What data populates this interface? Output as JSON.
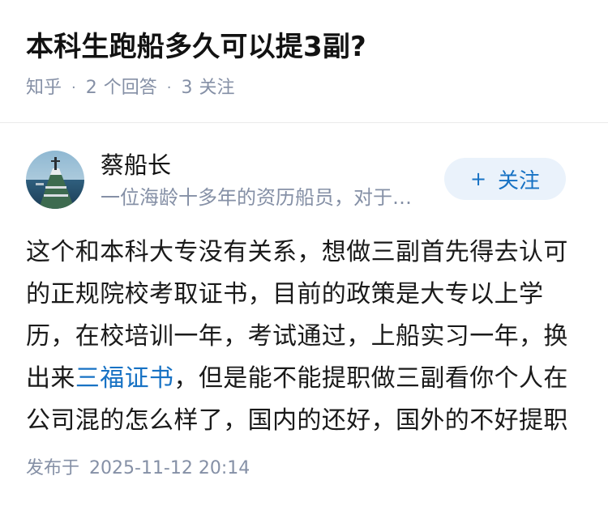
{
  "question": {
    "title": "本科生跑船多久可以提3副?",
    "source": "知乎",
    "answer_count": "2",
    "answer_label": "个回答",
    "follower_count": "3",
    "follower_label": "关注"
  },
  "answer": {
    "author_name": "蔡船长",
    "author_bio": "一位海龄十多年的资历船员，对于…",
    "follow_label": "关注",
    "follow_icon": "plus-icon",
    "content": {
      "line1": "这个和本科大专没有关系，想做三副首先得去认可",
      "line2": "的正规院校考取证书，目前的政策是大专以上学",
      "line3": "历，在校培训一年，考试通过，上船实习一年，换",
      "line4_before": "出来",
      "line4_link": "三福证书",
      "line4_after": "，但是能不能提职做三副看你个人在",
      "line5": "公司混的怎么样了，国内的还好，国外的不好提职"
    },
    "publish_label": "发布于",
    "publish_time": "2025-11-12 20:14"
  },
  "colors": {
    "accent": "#1772c4",
    "muted": "#8590a6",
    "follow_bg": "#eaf2fb",
    "divider": "#ebebeb"
  }
}
